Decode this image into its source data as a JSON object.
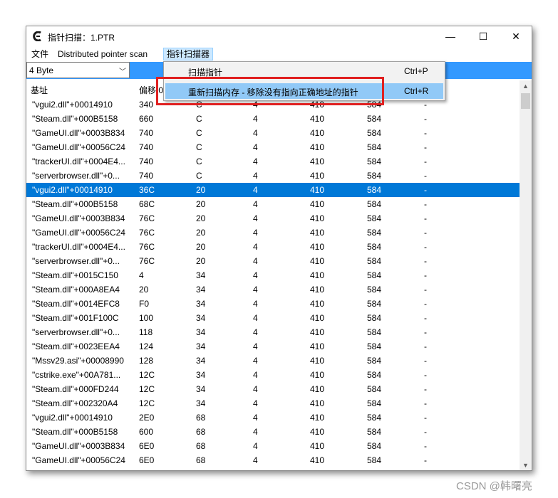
{
  "window": {
    "title": "指针扫描：1.PTR",
    "minimize": "—",
    "maximize": "☐",
    "close": "✕"
  },
  "menu": {
    "file": "文件",
    "distributed": "Distributed pointer scan",
    "scanner": "指针扫描器"
  },
  "dropdown": {
    "items": [
      {
        "label": "扫描指针",
        "shortcut": "Ctrl+P"
      },
      {
        "label": "重新扫描内存 - 移除没有指向正确地址的指针",
        "shortcut": "Ctrl+R"
      }
    ]
  },
  "toolbar": {
    "type_select": "4 Byte"
  },
  "table": {
    "headers": [
      "基址",
      "偏移 0"
    ],
    "selected_index": 6,
    "rows": [
      [
        "\"vgui2.dll\"+00014910",
        "340",
        "C",
        "4",
        "410",
        "584",
        "-"
      ],
      [
        "\"Steam.dll\"+000B5158",
        "660",
        "C",
        "4",
        "410",
        "584",
        "-"
      ],
      [
        "\"GameUI.dll\"+0003B834",
        "740",
        "C",
        "4",
        "410",
        "584",
        "-"
      ],
      [
        "\"GameUI.dll\"+00056C24",
        "740",
        "C",
        "4",
        "410",
        "584",
        "-"
      ],
      [
        "\"trackerUI.dll\"+0004E4...",
        "740",
        "C",
        "4",
        "410",
        "584",
        "-"
      ],
      [
        "\"serverbrowser.dll\"+0...",
        "740",
        "C",
        "4",
        "410",
        "584",
        "-"
      ],
      [
        "\"vgui2.dll\"+00014910",
        "36C",
        "20",
        "4",
        "410",
        "584",
        "-"
      ],
      [
        "\"Steam.dll\"+000B5158",
        "68C",
        "20",
        "4",
        "410",
        "584",
        "-"
      ],
      [
        "\"GameUI.dll\"+0003B834",
        "76C",
        "20",
        "4",
        "410",
        "584",
        "-"
      ],
      [
        "\"GameUI.dll\"+00056C24",
        "76C",
        "20",
        "4",
        "410",
        "584",
        "-"
      ],
      [
        "\"trackerUI.dll\"+0004E4...",
        "76C",
        "20",
        "4",
        "410",
        "584",
        "-"
      ],
      [
        "\"serverbrowser.dll\"+0...",
        "76C",
        "20",
        "4",
        "410",
        "584",
        "-"
      ],
      [
        "\"Steam.dll\"+0015C150",
        "4",
        "34",
        "4",
        "410",
        "584",
        "-"
      ],
      [
        "\"Steam.dll\"+000A8EA4",
        "20",
        "34",
        "4",
        "410",
        "584",
        "-"
      ],
      [
        "\"Steam.dll\"+0014EFC8",
        "F0",
        "34",
        "4",
        "410",
        "584",
        "-"
      ],
      [
        "\"Steam.dll\"+001F100C",
        "100",
        "34",
        "4",
        "410",
        "584",
        "-"
      ],
      [
        "\"serverbrowser.dll\"+0...",
        "118",
        "34",
        "4",
        "410",
        "584",
        "-"
      ],
      [
        "\"Steam.dll\"+0023EEA4",
        "124",
        "34",
        "4",
        "410",
        "584",
        "-"
      ],
      [
        "\"Mssv29.asi\"+00008990",
        "128",
        "34",
        "4",
        "410",
        "584",
        "-"
      ],
      [
        "\"cstrike.exe\"+00A781...",
        "12C",
        "34",
        "4",
        "410",
        "584",
        "-"
      ],
      [
        "\"Steam.dll\"+000FD244",
        "12C",
        "34",
        "4",
        "410",
        "584",
        "-"
      ],
      [
        "\"Steam.dll\"+002320A4",
        "12C",
        "34",
        "4",
        "410",
        "584",
        "-"
      ],
      [
        "\"vgui2.dll\"+00014910",
        "2E0",
        "68",
        "4",
        "410",
        "584",
        "-"
      ],
      [
        "\"Steam.dll\"+000B5158",
        "600",
        "68",
        "4",
        "410",
        "584",
        "-"
      ],
      [
        "\"GameUI.dll\"+0003B834",
        "6E0",
        "68",
        "4",
        "410",
        "584",
        "-"
      ],
      [
        "\"GameUI.dll\"+00056C24",
        "6E0",
        "68",
        "4",
        "410",
        "584",
        "-"
      ]
    ]
  },
  "watermark": "CSDN @韩曙亮",
  "colors": {
    "selection": "#0078d7",
    "toolbar_accent": "#3399ff",
    "highlight_box": "#e02020",
    "menu_hover": "#91c9f7"
  }
}
